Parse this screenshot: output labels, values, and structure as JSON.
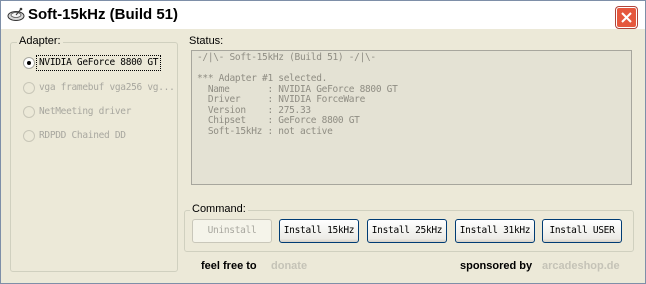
{
  "window": {
    "title": "Soft-15kHz (Build 51)",
    "app_icon": "satellite-dish-icon",
    "close_icon": "close-icon"
  },
  "adapter": {
    "label": "Adapter:",
    "options": [
      {
        "label": "NVIDIA GeForce 8800 GT",
        "selected": true,
        "enabled": true
      },
      {
        "label": "vga framebuf vga256 vg...",
        "selected": false,
        "enabled": false
      },
      {
        "label": "NetMeeting driver",
        "selected": false,
        "enabled": false
      },
      {
        "label": "RDPDD Chained DD",
        "selected": false,
        "enabled": false
      }
    ]
  },
  "status": {
    "label": "Status:",
    "lines": [
      "-/|\\- Soft-15kHz (Build 51) -/|\\-",
      "",
      "*** Adapter #1 selected.",
      "  Name       : NVIDIA GeForce 8800 GT",
      "  Driver     : NVIDIA ForceWare",
      "  Version    : 275.33",
      "  Chipset    : GeForce 8800 GT",
      "  Soft-15kHz : not active"
    ]
  },
  "command": {
    "label": "Command:",
    "buttons": [
      {
        "label": "Uninstall",
        "enabled": false
      },
      {
        "label": "Install 15kHz",
        "enabled": true
      },
      {
        "label": "Install 25kHz",
        "enabled": true
      },
      {
        "label": "Install 31kHz",
        "enabled": true
      },
      {
        "label": "Install USER",
        "enabled": true
      }
    ]
  },
  "footer": {
    "free_text": "feel free to",
    "donate_link": "donate",
    "sponsor_text": "sponsored by",
    "sponsor_link": "arcadeshop.de"
  }
}
